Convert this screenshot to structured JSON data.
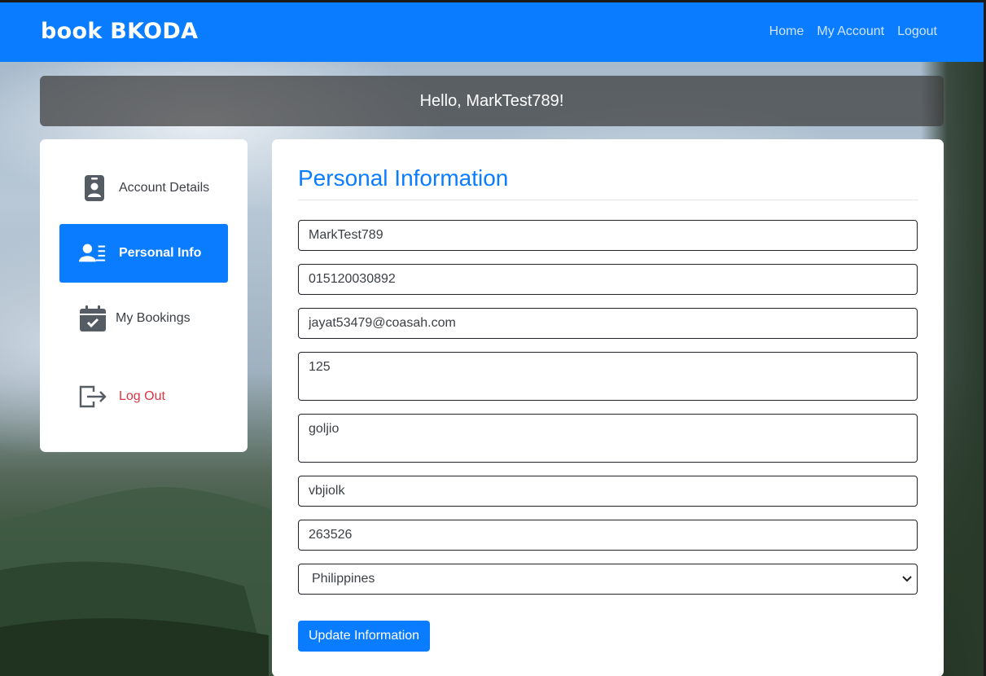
{
  "brand": "book BKODA",
  "nav": {
    "home": "Home",
    "my_account": "My Account",
    "logout": "Logout"
  },
  "greeting": {
    "prefix": "Hello, ",
    "username": "MarkTest789",
    "suffix": "!"
  },
  "sidebar": {
    "items": [
      {
        "label": "Account Details",
        "icon": "id-badge-icon"
      },
      {
        "label": "Personal Info",
        "icon": "user-list-icon",
        "active": true
      },
      {
        "label": "My Bookings",
        "icon": "calendar-check-icon"
      },
      {
        "label": "Log Out",
        "icon": "logout-icon"
      }
    ]
  },
  "form": {
    "title": "Personal Information",
    "username": "MarkTest789",
    "phone": "015120030892",
    "email": "jayat53479@coasah.com",
    "address_line1": "125",
    "address_line2": "goljio",
    "city": "vbjiolk",
    "postal_code": "263526",
    "country": "Philippines",
    "submit_label": "Update Information"
  },
  "colors": {
    "primary": "#0a7cff",
    "danger": "#dc3545"
  }
}
